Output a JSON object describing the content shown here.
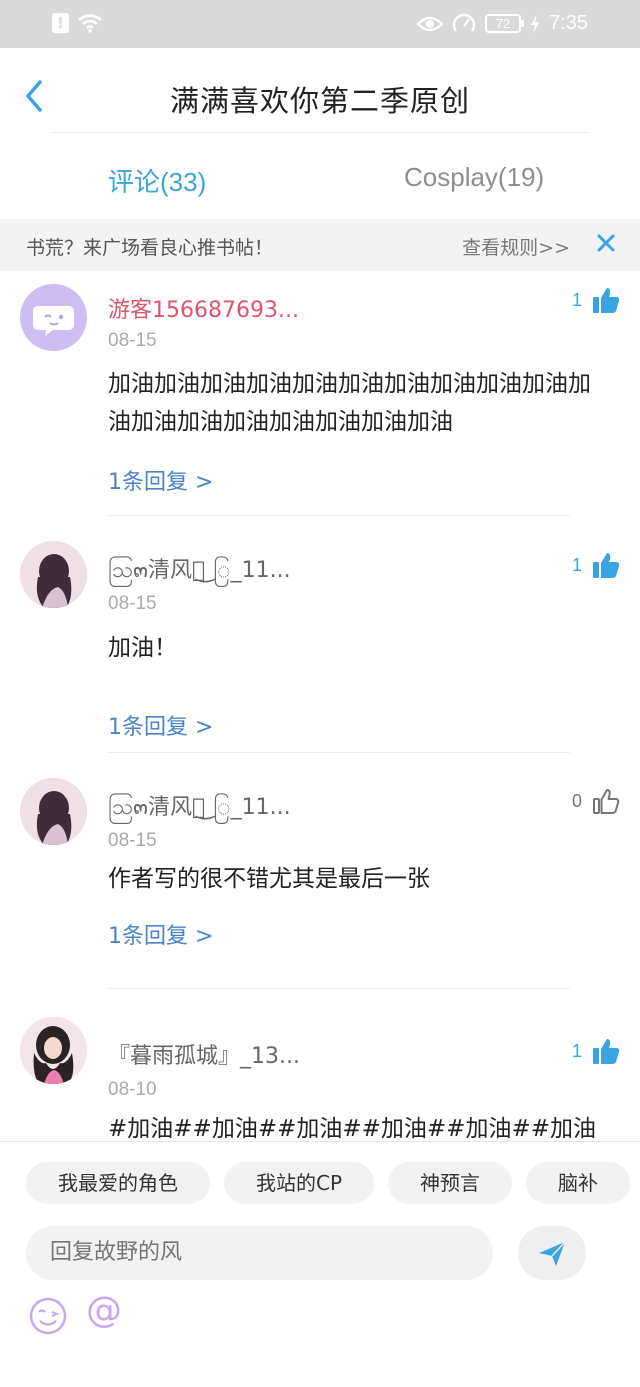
{
  "status_bar": {
    "time": "7:35",
    "battery": "72",
    "icons": [
      "alert-icon",
      "wifi-icon",
      "eye-icon",
      "speed-icon",
      "battery-icon",
      "charging-icon"
    ]
  },
  "header": {
    "title": "满满喜欢你第二季原创",
    "back_icon": "chevron-left-icon"
  },
  "tabs": [
    {
      "label": "评论(33)",
      "active": true
    },
    {
      "label": "Cosplay(19)",
      "active": false
    }
  ],
  "notice": {
    "text": "书荒？来广场看良心推书帖！",
    "rules": "查看规则>>",
    "close_icon": "close-icon"
  },
  "comments": [
    {
      "user": "游客156687693...",
      "date": "08-15",
      "text": "加油加油加油加油加油加油加油加油加油加油加油加油加油加油加油加油加油加油",
      "reply": "1条回复 >",
      "likes": "1",
      "liked": true
    },
    {
      "user": "ဩ๓清风ိ͜ ြ_11...",
      "date": "08-15",
      "text": "加油！",
      "reply": "1条回复 >",
      "likes": "1",
      "liked": true
    },
    {
      "user": "ဩ๓清风ိ͜ ြ_11...",
      "date": "08-15",
      "text": "作者写的很不错尤其是最后一张",
      "reply": "1条回复 >",
      "likes": "0",
      "liked": false
    },
    {
      "user": "『暮雨孤城』_13...",
      "date": "08-10",
      "text": "#加油##加油##加油##加油##加油##加油##加油##加油##加油##加油##加油##加油#",
      "reply": "",
      "likes": "1",
      "liked": true
    }
  ],
  "chips": [
    "我最爱的角色",
    "我站的CP",
    "神预言",
    "脑补"
  ],
  "reply_box": {
    "placeholder": "回复故野的风"
  },
  "colors": {
    "accent": "#39a4e0",
    "guest_name": "#e0546b",
    "reply_link": "#4a84c8",
    "emoji": "#c9a7ef"
  }
}
